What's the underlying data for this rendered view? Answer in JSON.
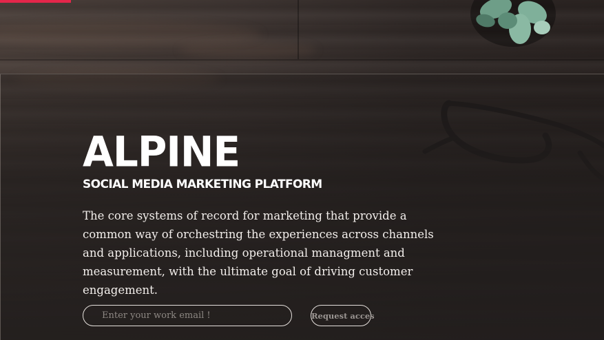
{
  "hero": {
    "title": "ALPINE",
    "subtitle": "SOCIAL MEDIA MARKETING PLATFORM",
    "description": "The core systems of record for marketing that provide a common way of orchestring the experiences across channels and applications, including operational managment and measurement, with the ultimate goal of driving customer engagement."
  },
  "signup": {
    "email_placeholder": "Enter your work email !",
    "email_value": "",
    "request_label": "Request acces"
  },
  "colors": {
    "accent": "#e4264a",
    "text": "#ffffff",
    "background": "#2a2422"
  },
  "icons": {
    "plant": "succulent-plant-icon",
    "glasses": "eyeglasses-icon"
  }
}
